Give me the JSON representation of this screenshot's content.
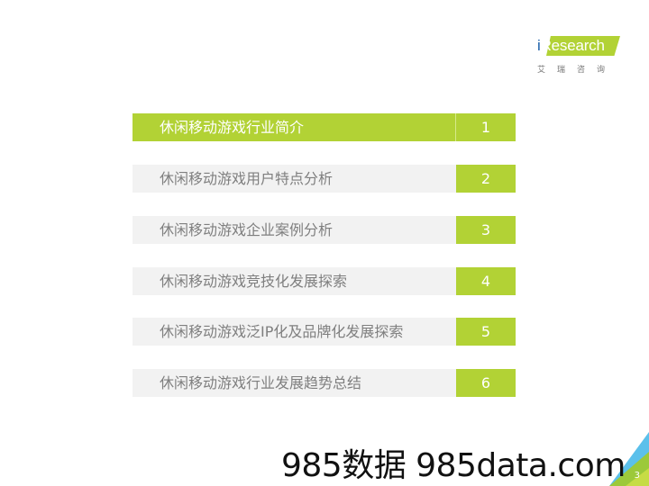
{
  "logo": {
    "brand": "Research",
    "brand_prefix": "i",
    "chinese_name": "艾瑞咨询",
    "colors": {
      "green": "#b2d235",
      "blue": "#1a5fa8"
    }
  },
  "toc": {
    "items": [
      {
        "label": "休闲移动游戏行业简介",
        "number": "1",
        "active": true
      },
      {
        "label": "休闲移动游戏用户特点分析",
        "number": "2",
        "active": false
      },
      {
        "label": "休闲移动游戏企业案例分析",
        "number": "3",
        "active": false
      },
      {
        "label": "休闲移动游戏竞技化发展探索",
        "number": "4",
        "active": false
      },
      {
        "label": "休闲移动游戏泛IP化及品牌化发展探索",
        "number": "5",
        "active": false
      },
      {
        "label": "休闲移动游戏行业发展趋势总结",
        "number": "6",
        "active": false
      }
    ],
    "colors": {
      "accent": "#b2d235",
      "bar": "#f2f2f2",
      "text": "#7f7f7f"
    }
  },
  "watermark": "985数据 985data.com",
  "page_number": "3"
}
